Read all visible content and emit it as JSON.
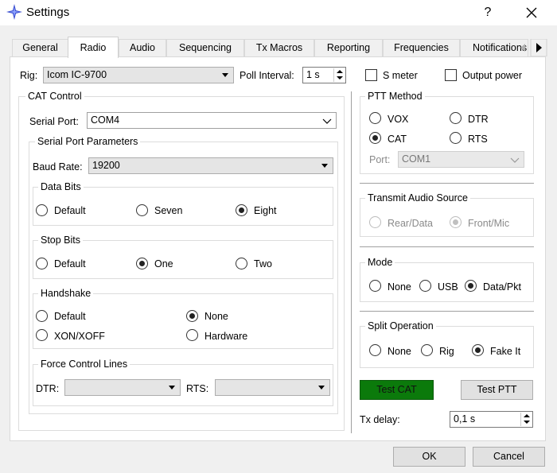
{
  "window": {
    "title": "Settings",
    "help_label": "?"
  },
  "tabs": [
    "General",
    "Radio",
    "Audio",
    "Sequencing",
    "Tx Macros",
    "Reporting",
    "Frequencies",
    "Notifications"
  ],
  "top": {
    "rig_label": "Rig:",
    "rig_value": "Icom IC-9700",
    "poll_label": "Poll Interval:",
    "poll_value": "1 s",
    "s_meter_label": "S meter",
    "output_power_label": "Output power"
  },
  "cat_control": {
    "title": "CAT Control",
    "serial_port_label": "Serial Port:",
    "serial_port_value": "COM4",
    "params_title": "Serial Port Parameters",
    "baud_label": "Baud Rate:",
    "baud_value": "19200",
    "data_bits": {
      "title": "Data Bits",
      "options": [
        "Default",
        "Seven",
        "Eight"
      ],
      "selected": "Eight"
    },
    "stop_bits": {
      "title": "Stop Bits",
      "options": [
        "Default",
        "One",
        "Two"
      ],
      "selected": "One"
    },
    "handshake": {
      "title": "Handshake",
      "options": [
        "Default",
        "None",
        "XON/XOFF",
        "Hardware"
      ],
      "selected": "None"
    },
    "force_lines": {
      "title": "Force Control Lines",
      "dtr_label": "DTR:",
      "dtr_value": "",
      "rts_label": "RTS:",
      "rts_value": ""
    }
  },
  "ptt": {
    "title": "PTT Method",
    "options": [
      "VOX",
      "DTR",
      "CAT",
      "RTS"
    ],
    "selected": "CAT",
    "port_label": "Port:",
    "port_value": "COM1"
  },
  "tx_audio": {
    "title": "Transmit Audio Source",
    "options": [
      "Rear/Data",
      "Front/Mic"
    ],
    "selected": "Front/Mic"
  },
  "mode": {
    "title": "Mode",
    "options": [
      "None",
      "USB",
      "Data/Pkt"
    ],
    "selected": "Data/Pkt"
  },
  "split": {
    "title": "Split Operation",
    "options": [
      "None",
      "Rig",
      "Fake It"
    ],
    "selected": "Fake It"
  },
  "buttons": {
    "test_cat": "Test CAT",
    "test_ptt": "Test PTT",
    "ok": "OK",
    "cancel": "Cancel"
  },
  "tx_delay": {
    "label": "Tx delay:",
    "value": "0,1 s"
  },
  "colors": {
    "test_cat_bg": "#0b7a0b",
    "panel_bg": "#ffffff",
    "window_bg": "#f0f0f0"
  },
  "icons": {
    "app": "compass-star-icon",
    "close": "close-icon",
    "tab_scroll": "scroll-right-icon"
  }
}
